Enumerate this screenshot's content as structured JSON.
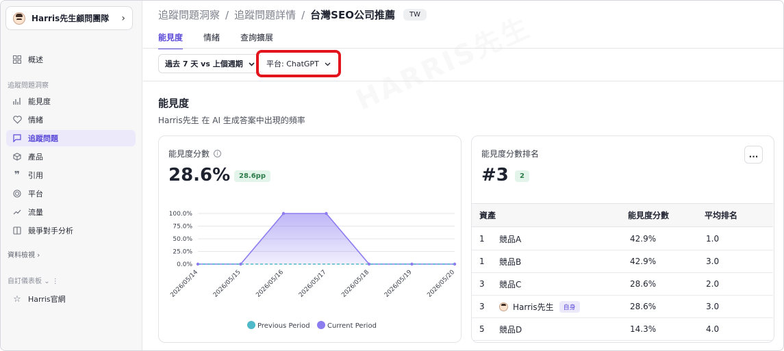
{
  "sidebar": {
    "team": "Harris先生顧問團隊",
    "overview": "概述",
    "section_tracking": "追蹤問題洞察",
    "items": [
      {
        "label": "能見度",
        "icon": "bar-chart-icon"
      },
      {
        "label": "情緒",
        "icon": "heart-icon"
      },
      {
        "label": "追蹤問題",
        "icon": "chat-bubble-icon"
      },
      {
        "label": "產品",
        "icon": "box-icon"
      },
      {
        "label": "引用",
        "icon": "quote-icon"
      },
      {
        "label": "平台",
        "icon": "radar-icon"
      },
      {
        "label": "流量",
        "icon": "trend-line-icon"
      },
      {
        "label": "競爭對手分析",
        "icon": "compare-icon"
      }
    ],
    "data_view": "資料檢視",
    "custom_dashboard": "自訂儀表板",
    "bookmark": "Harris官網"
  },
  "header": {
    "crumbs": [
      "追蹤問題洞察",
      "追蹤問題詳情",
      "台灣SEO公司推薦"
    ],
    "region_tag": "TW",
    "tabs": [
      "能見度",
      "情緒",
      "查詢擴展"
    ]
  },
  "filters": {
    "period": "過去 7 天 vs 上個週期",
    "platform": "平台: ChatGPT"
  },
  "section": {
    "title": "能見度",
    "subtitle": "Harris先生 在 AI 生成答案中出現的頻率"
  },
  "score_card": {
    "label": "能見度分數",
    "value": "28.6%",
    "delta": "28.6pp"
  },
  "rank_card": {
    "label": "能見度分數排名",
    "rank": "#3",
    "delta": "2",
    "more": "...",
    "columns": [
      "資產",
      "能見度分數",
      "平均排名"
    ],
    "rows": [
      {
        "rank": "1",
        "name": "競品A",
        "score": "42.9%",
        "avg": "1.0",
        "self": false
      },
      {
        "rank": "1",
        "name": "競品B",
        "score": "42.9%",
        "avg": "3.0",
        "self": false
      },
      {
        "rank": "3",
        "name": "競品C",
        "score": "28.6%",
        "avg": "2.0",
        "self": false
      },
      {
        "rank": "3",
        "name": "Harris先生",
        "score": "28.6%",
        "avg": "3.0",
        "self": true,
        "badge": "自身"
      },
      {
        "rank": "5",
        "name": "競品D",
        "score": "14.3%",
        "avg": "4.0",
        "self": false
      }
    ]
  },
  "chart_data": {
    "type": "area",
    "x": [
      "2026/05/14",
      "2026/05/15",
      "2026/05/16",
      "2026/05/17",
      "2026/05/18",
      "2026/05/19",
      "2026/05/20"
    ],
    "y_ticks": [
      "100.0%",
      "75.0%",
      "50.0%",
      "25.0%",
      "0.0%"
    ],
    "ylim": [
      0,
      100
    ],
    "series": [
      {
        "name": "Previous Period",
        "values": [
          0,
          0,
          0,
          0,
          0,
          0,
          0
        ],
        "color": "#4fb8c9"
      },
      {
        "name": "Current Period",
        "values": [
          0,
          0,
          100,
          100,
          0,
          0,
          0
        ],
        "color": "#8b7cf0"
      }
    ],
    "grid": true,
    "legend": "bottom"
  },
  "colors": {
    "accent": "#5b4bd8",
    "highlight": "#e3141b"
  }
}
